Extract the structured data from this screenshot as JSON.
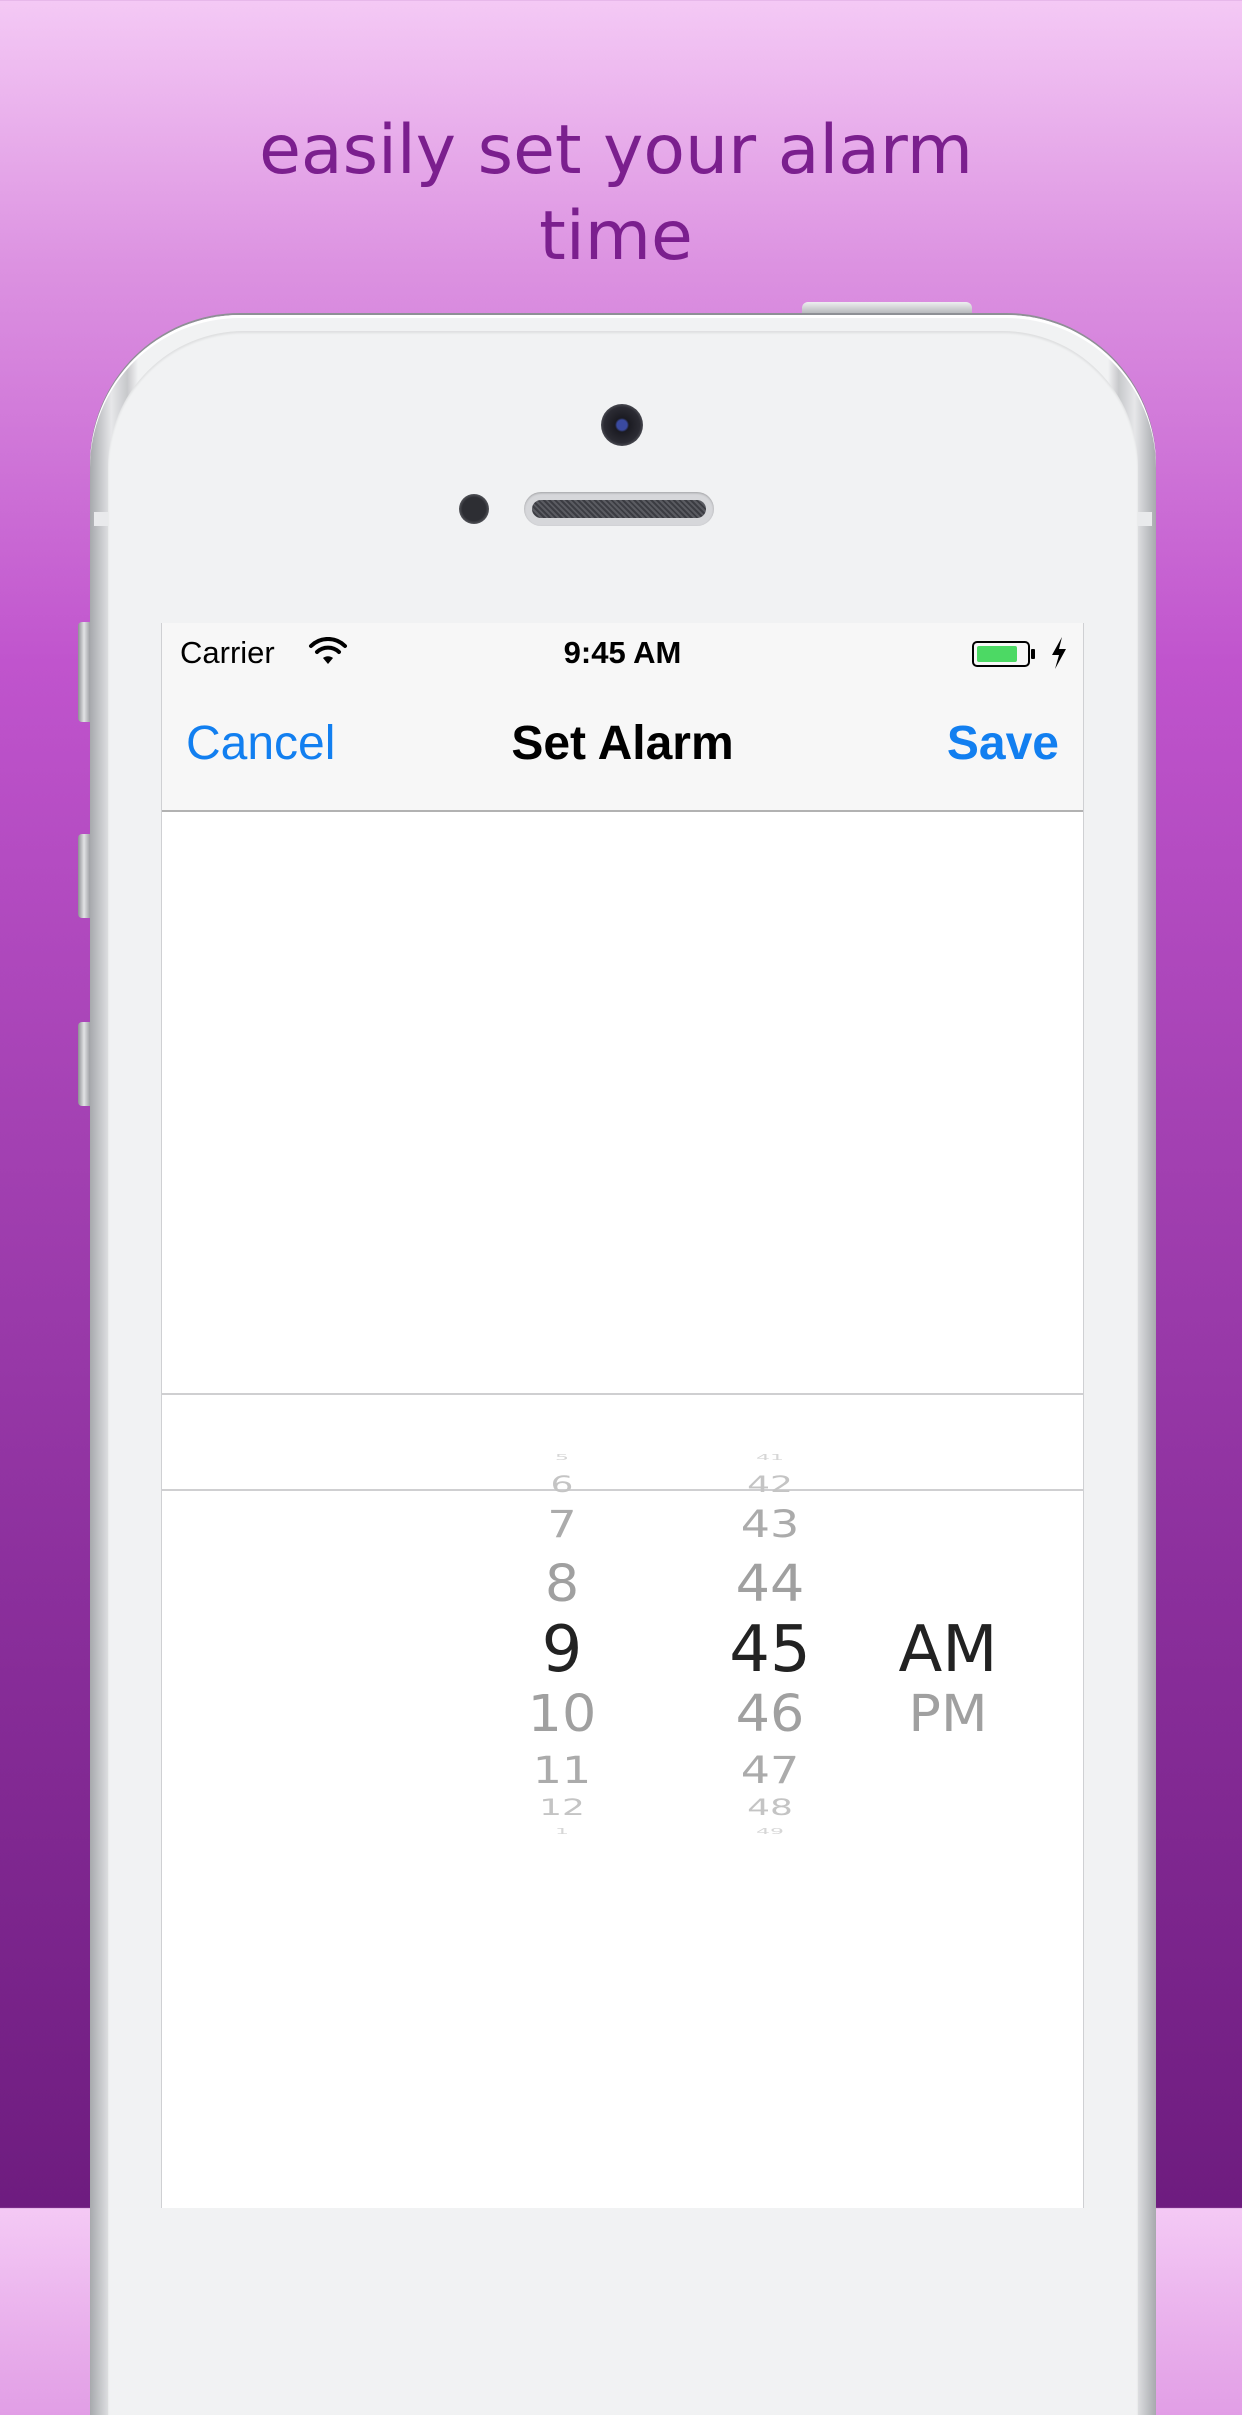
{
  "headline": {
    "line1": "easily set your alarm",
    "line2": "time"
  },
  "status_bar": {
    "carrier": "Carrier",
    "time": "9:45 AM",
    "wifi_icon": "wifi-icon",
    "battery_icon": "battery-icon",
    "charging_icon": "bolt-icon"
  },
  "nav_bar": {
    "cancel_label": "Cancel",
    "title": "Set Alarm",
    "save_label": "Save"
  },
  "picker": {
    "hours": [
      "5",
      "6",
      "7",
      "8",
      "9",
      "10",
      "11",
      "12",
      "1"
    ],
    "minutes": [
      "41",
      "42",
      "43",
      "44",
      "45",
      "46",
      "47",
      "48",
      "49"
    ],
    "periods": [
      "AM",
      "PM"
    ],
    "selected": {
      "hour": "9",
      "minute": "45",
      "period": "AM"
    }
  },
  "colors": {
    "accent": "#127ff0",
    "headline": "#7b1f8e",
    "selected_text": "#222222",
    "unselected_text": "#a0a0a0"
  }
}
